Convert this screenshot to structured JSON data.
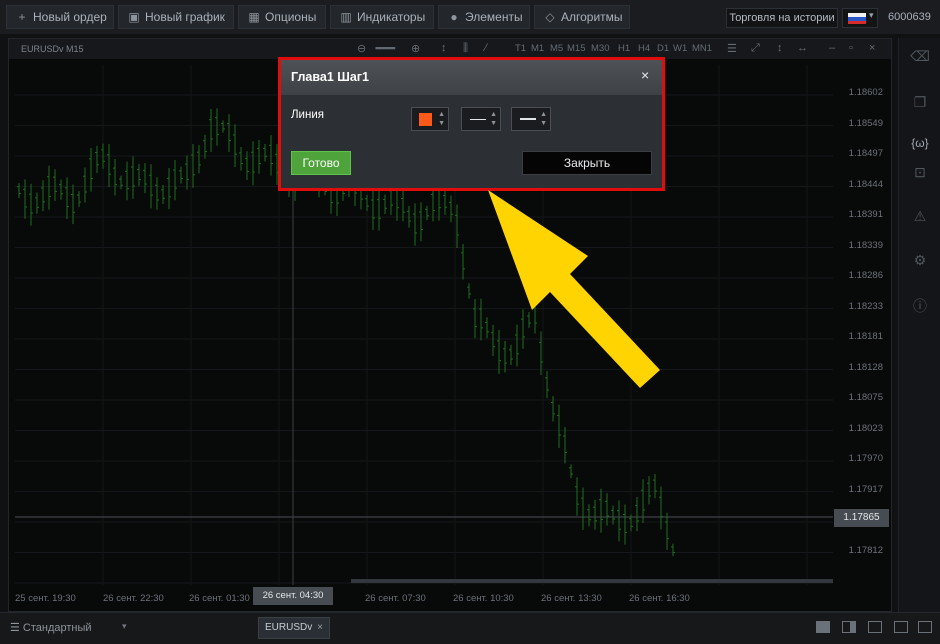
{
  "toolbar": {
    "buttons": [
      {
        "label": "Новый ордер",
        "icon": "plus-icon"
      },
      {
        "label": "Новый график",
        "icon": "chart-window-icon"
      },
      {
        "label": "Опционы",
        "icon": "options-icon"
      },
      {
        "label": "Индикаторы",
        "icon": "indicators-icon"
      },
      {
        "label": "Элементы",
        "icon": "elements-icon"
      },
      {
        "label": "Алгоритмы",
        "icon": "algorithms-icon"
      }
    ],
    "history_label": "Торговля на истории",
    "language_flag": "ru-flag-icon",
    "account": "6000639"
  },
  "chart": {
    "symbol_label": "EURUSDv M15",
    "timeframes": [
      "T1",
      "M1",
      "M5",
      "M15",
      "M30",
      "H1",
      "H4",
      "D1",
      "W1",
      "MN1"
    ],
    "price_labels": [
      "1.18602",
      "1.18549",
      "1.18497",
      "1.18444",
      "1.18391",
      "1.18339",
      "1.18286",
      "1.18233",
      "1.18181",
      "1.18128",
      "1.18075",
      "1.18023",
      "1.17970",
      "1.17917",
      "1.17865",
      "1.17812"
    ],
    "current_price": "1.17865",
    "time_labels": [
      "25 сент. 19:30",
      "26 сент. 22:30",
      "26 сент. 01:30",
      "26 сент. 07:30",
      "26 сент. 10:30",
      "26 сент. 13:30",
      "26 сент. 16:30"
    ],
    "time_cursor": "26 сент. 04:30"
  },
  "dialog": {
    "title": "Глава1 Шаг1",
    "close_glyph": "×",
    "line_label": "Линия",
    "line_color": "#ff5a1a",
    "done_label": "Готово",
    "close_label": "Закрыть"
  },
  "bottom": {
    "template": "Стандартный",
    "symbol_tab": "EURUSDv",
    "symbol_tab_close": "×"
  },
  "colors": {
    "highlight": "#e10d0d",
    "arrow": "#ffd400",
    "candles": "#1f6e1f",
    "done_button": "#4ea33a"
  }
}
